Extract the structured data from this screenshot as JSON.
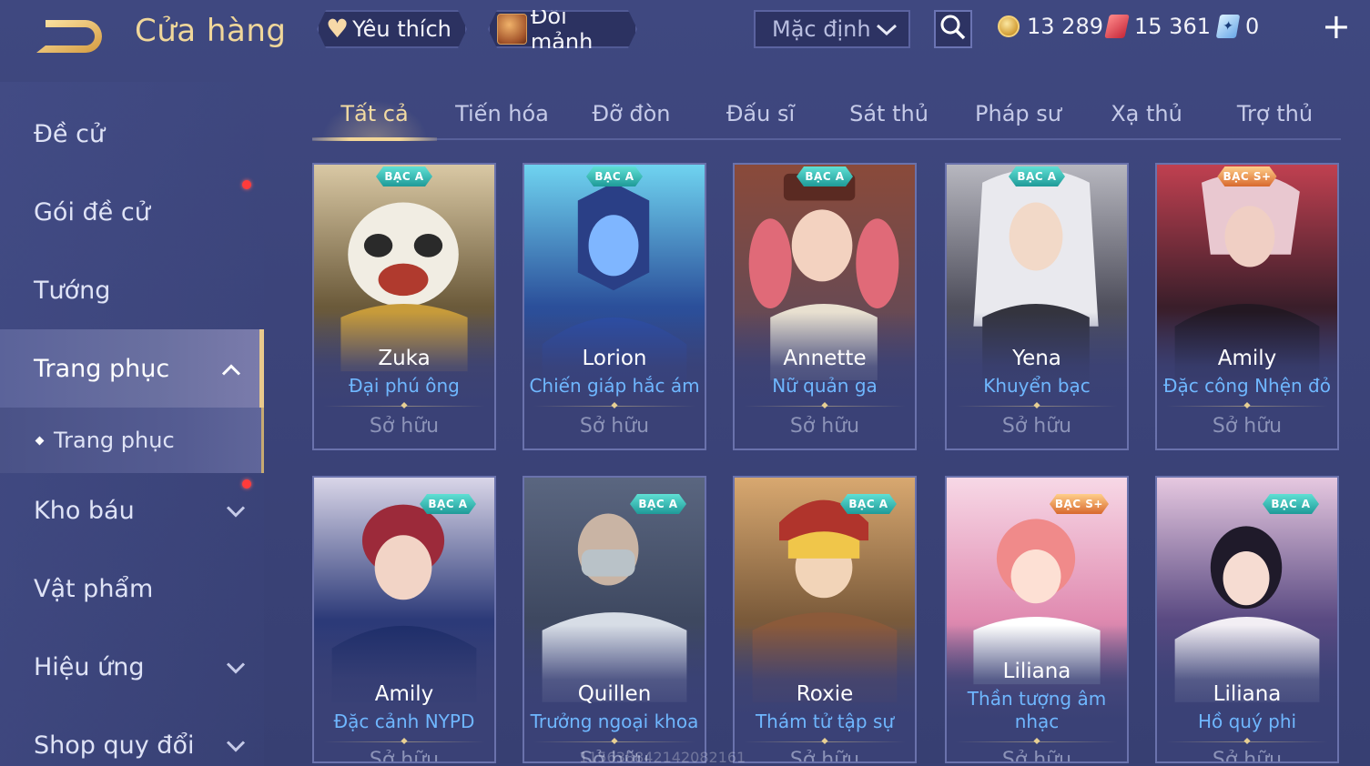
{
  "header": {
    "title": "Cửa hàng",
    "favorite_label": "Yêu thích",
    "exchange_label": "Đổi mảnh",
    "sort_value": "Mặc định",
    "currencies": [
      {
        "icon": "gold-coin-icon",
        "value": "13 289"
      },
      {
        "icon": "red-gem-icon",
        "value": "15 361"
      },
      {
        "icon": "voucher-icon",
        "value": "0"
      }
    ]
  },
  "sidebar": {
    "items": [
      {
        "label": "Đề cử"
      },
      {
        "label": "Gói đề cử"
      },
      {
        "label": "Tướng"
      },
      {
        "label": "Trang phục"
      },
      {
        "label": "Trang phục"
      },
      {
        "label": "Kho báu"
      },
      {
        "label": "Vật phẩm"
      },
      {
        "label": "Hiệu ứng"
      },
      {
        "label": "Shop quy đổi"
      }
    ]
  },
  "tabs": [
    "Tất cả",
    "Tiến hóa",
    "Đỡ đòn",
    "Đấu sĩ",
    "Sát thủ",
    "Pháp sư",
    "Xạ thủ",
    "Trợ thủ"
  ],
  "cards": [
    {
      "hero": "Zuka",
      "skin": "Đại phú ông",
      "badge": "BẠC A",
      "status": "Sở hữu"
    },
    {
      "hero": "Lorion",
      "skin": "Chiến giáp hắc ám",
      "badge": "BẠC A",
      "status": "Sở hữu"
    },
    {
      "hero": "Annette",
      "skin": "Nữ quản ga",
      "badge": "BẠC A",
      "status": "Sở hữu"
    },
    {
      "hero": "Yena",
      "skin": "Khuyển bạc",
      "badge": "BẠC A",
      "status": "Sở hữu"
    },
    {
      "hero": "Amily",
      "skin": "Đặc công Nhện đỏ",
      "badge": "BẠC S+",
      "status": "Sở hữu"
    },
    {
      "hero": "Amily",
      "skin": "Đặc cảnh NYPD",
      "badge": "BẠC A",
      "status": "Sở hữu"
    },
    {
      "hero": "Quillen",
      "skin": "Trưởng ngoại khoa",
      "badge": "BẠC A",
      "status": "Sở hữu"
    },
    {
      "hero": "Roxie",
      "skin": "Thám tử tập sự",
      "badge": "BẠC A",
      "status": "Sở hữu"
    },
    {
      "hero": "Liliana",
      "skin": "Thần tượng âm nhạc",
      "badge": "BẠC S+",
      "status": "Sở hữu"
    },
    {
      "hero": "Liliana",
      "skin": "Hồ quý phi",
      "badge": "BẠC A",
      "status": "Sở hữu"
    }
  ],
  "watermark": "115638842142082161",
  "colors": {
    "background": "#3c447a",
    "accent_gold": "#f2d697",
    "skin_name_blue": "#6fb7ff",
    "badge_teal": "#1f9a98",
    "badge_orange": "#d8692e",
    "notification_red": "#ff3b3b"
  }
}
